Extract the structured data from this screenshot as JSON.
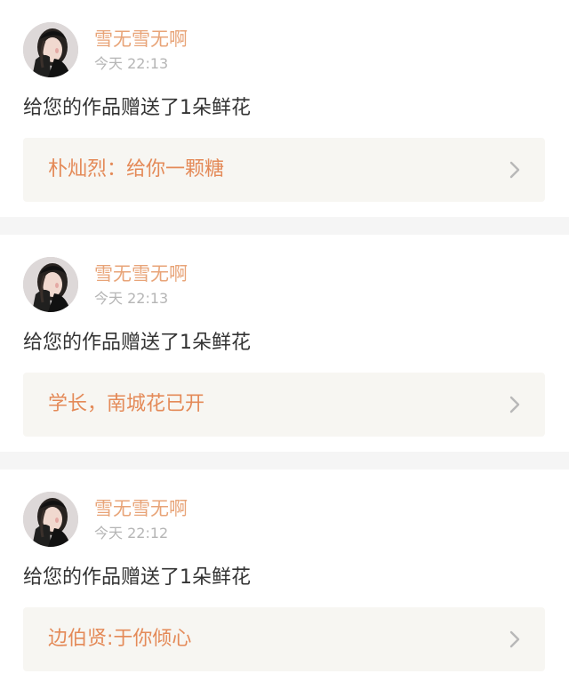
{
  "notifications": [
    {
      "user_name": "雪无雪无啊",
      "time": "今天 22:13",
      "message": "给您的作品赠送了1朵鲜花",
      "work_title": "朴灿烈：给你一颗糖",
      "avatar_icon": "user-avatar-photo",
      "arrow_icon": "chevron-right-icon"
    },
    {
      "user_name": "雪无雪无啊",
      "time": "今天 22:13",
      "message": "给您的作品赠送了1朵鲜花",
      "work_title": "学长，南城花已开",
      "avatar_icon": "user-avatar-photo",
      "arrow_icon": "chevron-right-icon"
    },
    {
      "user_name": "雪无雪无啊",
      "time": "今天 22:12",
      "message": "给您的作品赠送了1朵鲜花",
      "work_title": "边伯贤:于你倾心",
      "avatar_icon": "user-avatar-photo",
      "arrow_icon": "chevron-right-icon"
    }
  ],
  "colors": {
    "background": "#f5f5f5",
    "card": "#ffffff",
    "user_name": "#e8a478",
    "time": "#b5b5b5",
    "message": "#333333",
    "work_link_bg": "#f7f6f2",
    "work_title": "#e48a58",
    "chevron": "#b8b8b8"
  }
}
